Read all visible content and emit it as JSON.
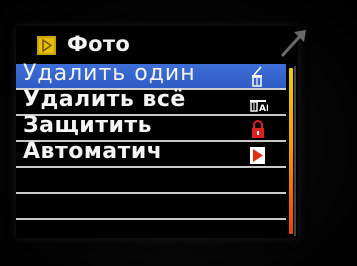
{
  "header": {
    "title": "Фото",
    "icon": "play-file-icon"
  },
  "menu": {
    "items": [
      {
        "label": "Удалить один",
        "icon": "trash-single-icon",
        "selected": true
      },
      {
        "label": "Удалить всё",
        "icon": "trash-all-icon",
        "selected": false
      },
      {
        "label": "Защитить",
        "icon": "lock-icon",
        "selected": false
      },
      {
        "label": "Автоматич",
        "icon": "play-icon",
        "selected": false
      }
    ],
    "total_rows": 6
  },
  "colors": {
    "selection": "#3b6ad6",
    "text": "#f4f4f4",
    "divider": "#c8c8c8",
    "accent_yellow": "#e8c000",
    "accent_red": "#e02020"
  }
}
